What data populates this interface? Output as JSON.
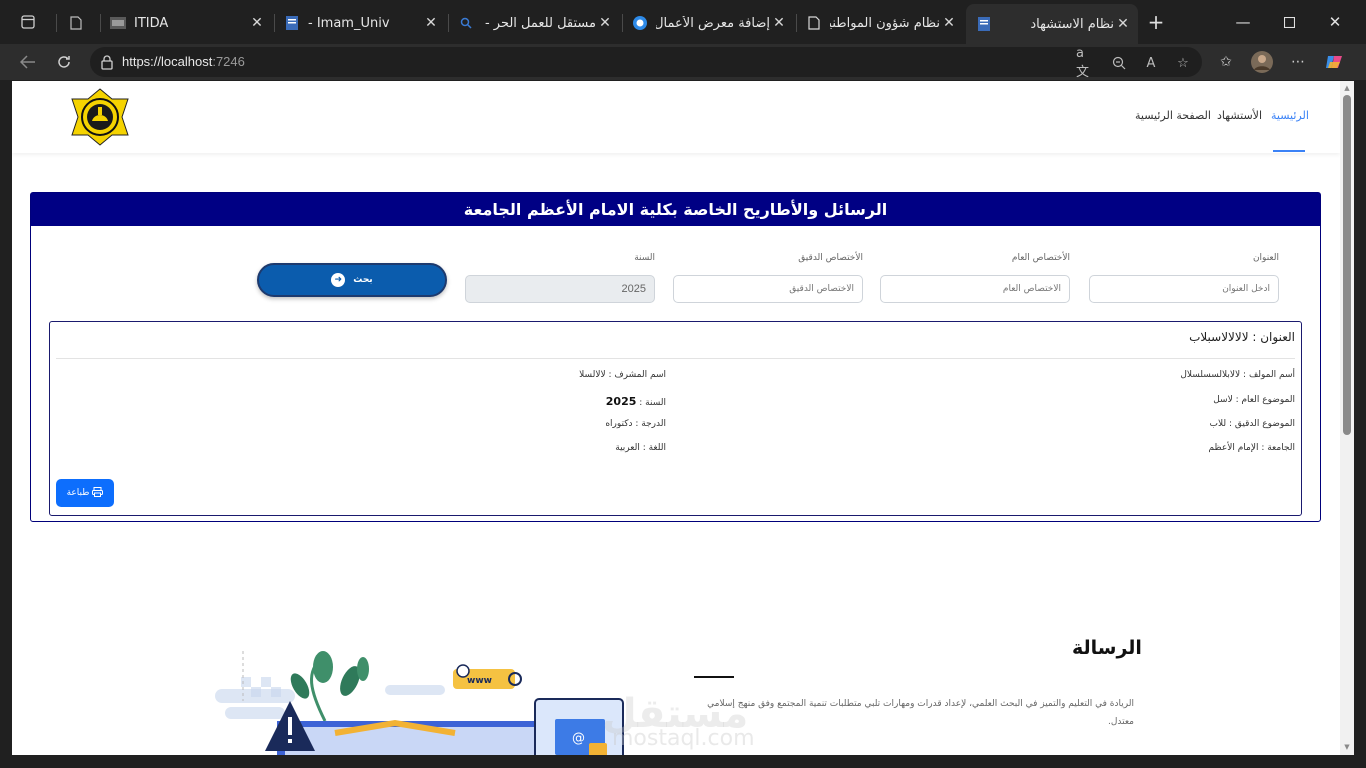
{
  "browser": {
    "tabs": [
      {
        "title": "",
        "icon": "page-icon"
      },
      {
        "title": "ITIDA",
        "icon": "itida-favicon"
      },
      {
        "title": "- Imam_Univ",
        "icon": "doc-icon"
      },
      {
        "title": "مستقل للعمل الحر - h",
        "icon": "search-favicon"
      },
      {
        "title": "إضافة معرض الأعمال",
        "icon": "circle-favicon"
      },
      {
        "title": "نظام شؤون المواطنين",
        "icon": "page-icon"
      },
      {
        "title": "نظام الاستشهاد",
        "icon": "doc-icon",
        "active": true
      }
    ],
    "url_host": "https://localhost",
    "url_port": ":7246"
  },
  "site": {
    "nav": {
      "home_active": "الرئيسية",
      "citation": "الأستشهاد",
      "main_page": "الصفحة الرئيسية"
    }
  },
  "search": {
    "header": "الرسائل والأطاريح الخاصة بكلية الامام الأعظم الجامعة",
    "fields": {
      "title_label": "العنوان",
      "title_placeholder": "أدخل العنوان",
      "general_label": "الأختصاص العام",
      "general_placeholder": "الأختصاص العام",
      "specific_label": "الأختصاص الدقيق",
      "specific_placeholder": "الأختصاص الدقيق",
      "year_label": "السنة",
      "year_value": "2025"
    },
    "button_label": "بحث"
  },
  "result": {
    "title": "العنوان : لالالالاسبلاب",
    "author": "أسم المولف : لالابلالسسلسلال",
    "supervisor": "اسم المشرف : لالالسلا",
    "general_topic": "الموضوع العام : لاسل",
    "year_label": "السنة :",
    "year_value": "2025",
    "specific_topic": "الموضوع الدقيق : للاب",
    "degree": "الدرجة : دكتوراه",
    "university": "الجامعة : الإمام الأعظم",
    "language": "اللغة : العربية",
    "print_label": "طباعة"
  },
  "message": {
    "title": "الرسالة",
    "text": "الريادة في التعليم والتميز في البحث العلمي، لإعداد قدرات ومهارات تلبي متطلبات تنمية المجتمع وفق منهج إسلامي معتدل.",
    "watermark": "مستقل",
    "watermark_sub": "mostaql.com"
  }
}
